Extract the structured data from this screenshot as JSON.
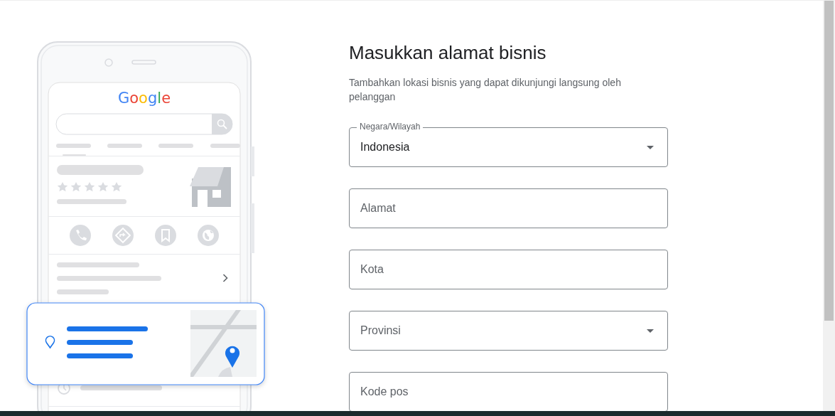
{
  "illustration": {
    "logo": "Google"
  },
  "form": {
    "title": "Masukkan alamat bisnis",
    "subtitle": "Tambahkan lokasi bisnis yang dapat dikunjungi langsung oleh pelanggan",
    "fields": [
      {
        "kind": "select",
        "label": "Negara/Wilayah",
        "value": "Indonesia"
      },
      {
        "kind": "text",
        "placeholder": "Alamat"
      },
      {
        "kind": "text",
        "placeholder": "Kota"
      },
      {
        "kind": "select",
        "placeholder": "Provinsi"
      },
      {
        "kind": "text",
        "placeholder": "Kode pos"
      }
    ]
  }
}
